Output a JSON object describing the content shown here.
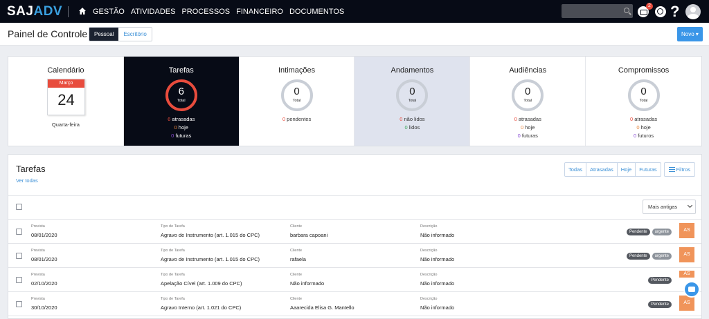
{
  "nav": {
    "logo_saj": "SAJ",
    "logo_adv": "ADV",
    "links": [
      "GESTÃO",
      "ATIVIDADES",
      "PROCESSOS",
      "FINANCEIRO",
      "DOCUMENTOS"
    ],
    "mail_badge": "2"
  },
  "header": {
    "title": "Painel de Controle",
    "segments": [
      "Pessoal",
      "Escritório"
    ],
    "novo": "Novo ▾"
  },
  "cards": {
    "calendario": {
      "title": "Calendário",
      "month": "Março",
      "day": "24",
      "weekday": "Quarta-feira"
    },
    "tarefas": {
      "title": "Tarefas",
      "total": "6",
      "total_label": "Total",
      "atrasadas_n": "6",
      "atrasadas": "atrasadas",
      "hoje_n": "0",
      "hoje": "hoje",
      "futuras_n": "0",
      "futuras": "futuras"
    },
    "intimacoes": {
      "title": "Intimações",
      "total": "0",
      "total_label": "Total",
      "pendentes_n": "0",
      "pendentes": "pendentes"
    },
    "andamentos": {
      "title": "Andamentos",
      "total": "0",
      "total_label": "Total",
      "naolidos_n": "0",
      "naolidos": "não lidos",
      "lidos_n": "0",
      "lidos": "lidos"
    },
    "audiencias": {
      "title": "Audiências",
      "total": "0",
      "total_label": "Total",
      "atrasadas_n": "0",
      "atrasadas": "atrasadas",
      "hoje_n": "0",
      "hoje": "hoje",
      "futuras_n": "0",
      "futuras": "futuras"
    },
    "compromissos": {
      "title": "Compromissos",
      "total": "0",
      "total_label": "Total",
      "atrasadas_n": "0",
      "atrasadas": "atrasadas",
      "hoje_n": "0",
      "hoje": "hoje",
      "futuros_n": "0",
      "futuros": "futuros"
    }
  },
  "tasks": {
    "title": "Tarefas",
    "ver_todas": "Ver todas",
    "filters": [
      "Todas",
      "Atrasadas",
      "Hoje",
      "Futuras"
    ],
    "filtros": "Filtros",
    "sort": "Mais antigas",
    "labels": {
      "prevista": "Prevista",
      "tipo": "Tipo de Tarefa",
      "cliente": "Cliente",
      "descricao": "Descrição"
    },
    "rows": [
      {
        "prevista": "08/01/2020",
        "tipo": "Agravo de Instrumento (art. 1.015 do CPC)",
        "cliente": "barbara capoani",
        "descricao": "Não informado",
        "status": "Pendente",
        "priority": "urgente",
        "initials": "AS"
      },
      {
        "prevista": "08/01/2020",
        "tipo": "Agravo de Instrumento (art. 1.015 do CPC)",
        "cliente": "rafaela",
        "descricao": "Não informado",
        "status": "Pendente",
        "priority": "urgente",
        "initials": "AS"
      },
      {
        "prevista": "02/10/2020",
        "tipo": "Apelação Cível (art. 1.009 do CPC)",
        "cliente": "Não informado",
        "descricao": "Não informado",
        "status": "Pendente",
        "priority": "",
        "initials": "AS"
      },
      {
        "prevista": "30/10/2020",
        "tipo": "Agravo Interno (art. 1.021 do CPC)",
        "cliente": "Aaarecida Elisa G. Mantello",
        "descricao": "Não informado",
        "status": "Pendente",
        "priority": "",
        "initials": "AS"
      }
    ]
  },
  "colors": {
    "nav_bg": "#070b16",
    "accent": "#3a96e8",
    "red": "#e84c3d",
    "orange_badge": "#f0945a"
  }
}
